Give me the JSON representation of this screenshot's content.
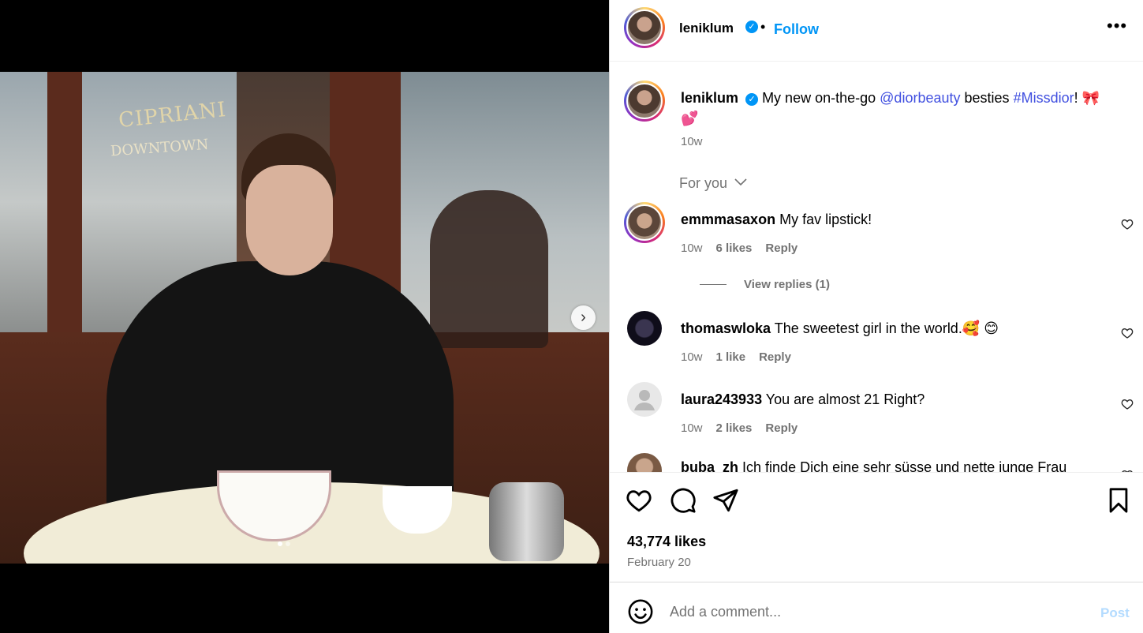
{
  "post": {
    "username": "leniklum",
    "follow_label": "Follow",
    "separator": "•",
    "more_label": "•••",
    "caption": {
      "username": "leniklum",
      "text_before": "My new on-the-go",
      "mention": "@diorbeauty",
      "text_middle": "besties",
      "hashtag": "#Missdior",
      "text_end": "!",
      "emoji1": "🎀",
      "emoji2": "💕",
      "time": "10w"
    },
    "for_you_label": "For you",
    "likes": "43,774 likes",
    "date": "February 20",
    "carousel": {
      "current": 1,
      "total": 2
    }
  },
  "photo": {
    "sign_line1": "CIPRIANI",
    "sign_line2": "DOWNTOWN"
  },
  "comments": [
    {
      "username": "emmmasaxon",
      "text": "My fav lipstick!",
      "time": "10w",
      "likes": "6 likes",
      "reply": "Reply",
      "view_replies": "View replies (1)"
    },
    {
      "username": "thomaswloka",
      "text": "The sweetest girl in the world.🥰 😊",
      "time": "10w",
      "likes": "1 like",
      "reply": "Reply"
    },
    {
      "username": "laura243933",
      "text": "You are almost 21 Right?",
      "time": "10w",
      "likes": "2 likes",
      "reply": "Reply"
    },
    {
      "username": "buba_zh",
      "text": "Ich finde Dich eine sehr süsse und nette junge Frau"
    }
  ],
  "comment_box": {
    "placeholder": "Add a comment...",
    "post_label": "Post"
  },
  "colors": {
    "accent": "#0095f6",
    "link": "#4150e0",
    "muted": "#737373"
  },
  "icons": {
    "like": "heart-icon",
    "comment": "comment-icon",
    "share": "paper-plane-icon",
    "save": "bookmark-icon",
    "emoji": "smiley-icon",
    "next": "chevron-right-icon"
  }
}
